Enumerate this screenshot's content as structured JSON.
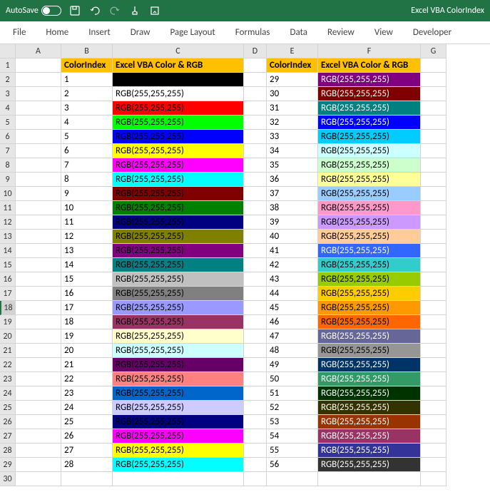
{
  "titlebar": {
    "autosave": "AutoSave",
    "toggle": "Off",
    "doc_title": "Excel VBA ColorIndex"
  },
  "ribbon": {
    "file": "File",
    "home": "Home",
    "insert": "Insert",
    "draw": "Draw",
    "page_layout": "Page Layout",
    "formulas": "Formulas",
    "data": "Data",
    "review": "Review",
    "view": "View",
    "developer": "Developer"
  },
  "columns": [
    "A",
    "B",
    "C",
    "D",
    "E",
    "F",
    "G"
  ],
  "row_count": 30,
  "selected_row": 18,
  "headers": {
    "b": "ColorIndex",
    "c": "Excel VBA Color & RGB",
    "e": "ColorIndex",
    "f": "Excel VBA Color & RGB"
  },
  "left": [
    {
      "idx": "1",
      "txt": "",
      "bg": "#000000",
      "fg": "#fff"
    },
    {
      "idx": "2",
      "txt": "RGB(255,255,255)",
      "bg": "#ffffff",
      "fg": "#000"
    },
    {
      "idx": "3",
      "txt": "RGB(255,255,255)",
      "bg": "#ff0000",
      "fg": "#000"
    },
    {
      "idx": "4",
      "txt": "RGB(255,255,255)",
      "bg": "#00ff00",
      "fg": "#000"
    },
    {
      "idx": "5",
      "txt": "RGB(255,255,255)",
      "bg": "#0000ff",
      "fg": "#000"
    },
    {
      "idx": "6",
      "txt": "RGB(255,255,255)",
      "bg": "#ffff00",
      "fg": "#000"
    },
    {
      "idx": "7",
      "txt": "RGB(255,255,255)",
      "bg": "#ff00ff",
      "fg": "#000"
    },
    {
      "idx": "8",
      "txt": "RGB(255,255,255)",
      "bg": "#00ffff",
      "fg": "#000"
    },
    {
      "idx": "9",
      "txt": "RGB(255,255,255)",
      "bg": "#800000",
      "fg": "#000"
    },
    {
      "idx": "10",
      "txt": "RGB(255,255,255)",
      "bg": "#008000",
      "fg": "#000"
    },
    {
      "idx": "11",
      "txt": "RGB(255,255,255)",
      "bg": "#000080",
      "fg": "#000"
    },
    {
      "idx": "12",
      "txt": "RGB(255,255,255)",
      "bg": "#808000",
      "fg": "#000"
    },
    {
      "idx": "13",
      "txt": "RGB(255,255,255)",
      "bg": "#800080",
      "fg": "#000"
    },
    {
      "idx": "14",
      "txt": "RGB(255,255,255)",
      "bg": "#008080",
      "fg": "#000"
    },
    {
      "idx": "15",
      "txt": "RGB(255,255,255)",
      "bg": "#c0c0c0",
      "fg": "#000"
    },
    {
      "idx": "16",
      "txt": "RGB(255,255,255)",
      "bg": "#808080",
      "fg": "#000"
    },
    {
      "idx": "17",
      "txt": "RGB(255,255,255)",
      "bg": "#9999ff",
      "fg": "#000"
    },
    {
      "idx": "18",
      "txt": "RGB(255,255,255)",
      "bg": "#993366",
      "fg": "#000"
    },
    {
      "idx": "19",
      "txt": "RGB(255,255,255)",
      "bg": "#ffffcc",
      "fg": "#000"
    },
    {
      "idx": "20",
      "txt": "RGB(255,255,255)",
      "bg": "#ccffff",
      "fg": "#000"
    },
    {
      "idx": "21",
      "txt": "RGB(255,255,255)",
      "bg": "#660066",
      "fg": "#000"
    },
    {
      "idx": "22",
      "txt": "RGB(255,255,255)",
      "bg": "#ff8080",
      "fg": "#000"
    },
    {
      "idx": "23",
      "txt": "RGB(255,255,255)",
      "bg": "#0066cc",
      "fg": "#000"
    },
    {
      "idx": "24",
      "txt": "RGB(255,255,255)",
      "bg": "#ccccff",
      "fg": "#000"
    },
    {
      "idx": "25",
      "txt": "RGB(255,255,255)",
      "bg": "#000080",
      "fg": "#000"
    },
    {
      "idx": "26",
      "txt": "RGB(255,255,255)",
      "bg": "#ff00ff",
      "fg": "#000"
    },
    {
      "idx": "27",
      "txt": "RGB(255,255,255)",
      "bg": "#ffff00",
      "fg": "#000"
    },
    {
      "idx": "28",
      "txt": "RGB(255,255,255)",
      "bg": "#00ffff",
      "fg": "#000"
    }
  ],
  "right": [
    {
      "idx": "29",
      "txt": "RGB(255,255,255)",
      "bg": "#800080",
      "fg": "#fff"
    },
    {
      "idx": "30",
      "txt": "RGB(255,255,255)",
      "bg": "#800000",
      "fg": "#fff"
    },
    {
      "idx": "31",
      "txt": "RGB(255,255,255)",
      "bg": "#008080",
      "fg": "#fff"
    },
    {
      "idx": "32",
      "txt": "RGB(255,255,255)",
      "bg": "#0000ff",
      "fg": "#fff"
    },
    {
      "idx": "33",
      "txt": "RGB(255,255,255)",
      "bg": "#00ccff",
      "fg": "#000"
    },
    {
      "idx": "34",
      "txt": "RGB(255,255,255)",
      "bg": "#ccffff",
      "fg": "#000"
    },
    {
      "idx": "35",
      "txt": "RGB(255,255,255)",
      "bg": "#ccffcc",
      "fg": "#000"
    },
    {
      "idx": "36",
      "txt": "RGB(255,255,255)",
      "bg": "#ffff99",
      "fg": "#000"
    },
    {
      "idx": "37",
      "txt": "RGB(255,255,255)",
      "bg": "#99ccff",
      "fg": "#000"
    },
    {
      "idx": "38",
      "txt": "RGB(255,255,255)",
      "bg": "#ff99cc",
      "fg": "#000"
    },
    {
      "idx": "39",
      "txt": "RGB(255,255,255)",
      "bg": "#cc99ff",
      "fg": "#000"
    },
    {
      "idx": "40",
      "txt": "RGB(255,255,255)",
      "bg": "#ffcc99",
      "fg": "#000"
    },
    {
      "idx": "41",
      "txt": "RGB(255,255,255)",
      "bg": "#3366ff",
      "fg": "#fff"
    },
    {
      "idx": "42",
      "txt": "RGB(255,255,255)",
      "bg": "#33cccc",
      "fg": "#000"
    },
    {
      "idx": "43",
      "txt": "RGB(255,255,255)",
      "bg": "#99cc00",
      "fg": "#000"
    },
    {
      "idx": "44",
      "txt": "RGB(255,255,255)",
      "bg": "#ffcc00",
      "fg": "#000"
    },
    {
      "idx": "45",
      "txt": "RGB(255,255,255)",
      "bg": "#ff9900",
      "fg": "#000"
    },
    {
      "idx": "46",
      "txt": "RGB(255,255,255)",
      "bg": "#ff6600",
      "fg": "#000"
    },
    {
      "idx": "47",
      "txt": "RGB(255,255,255)",
      "bg": "#666699",
      "fg": "#fff"
    },
    {
      "idx": "48",
      "txt": "RGB(255,255,255)",
      "bg": "#969696",
      "fg": "#000"
    },
    {
      "idx": "49",
      "txt": "RGB(255,255,255)",
      "bg": "#003366",
      "fg": "#fff"
    },
    {
      "idx": "50",
      "txt": "RGB(255,255,255)",
      "bg": "#339966",
      "fg": "#fff"
    },
    {
      "idx": "51",
      "txt": "RGB(255,255,255)",
      "bg": "#003300",
      "fg": "#fff"
    },
    {
      "idx": "52",
      "txt": "RGB(255,255,255)",
      "bg": "#333300",
      "fg": "#fff"
    },
    {
      "idx": "53",
      "txt": "RGB(255,255,255)",
      "bg": "#993300",
      "fg": "#fff"
    },
    {
      "idx": "54",
      "txt": "RGB(255,255,255)",
      "bg": "#993366",
      "fg": "#fff"
    },
    {
      "idx": "55",
      "txt": "RGB(255,255,255)",
      "bg": "#333399",
      "fg": "#fff"
    },
    {
      "idx": "56",
      "txt": "RGB(255,255,255)",
      "bg": "#333333",
      "fg": "#fff"
    }
  ]
}
